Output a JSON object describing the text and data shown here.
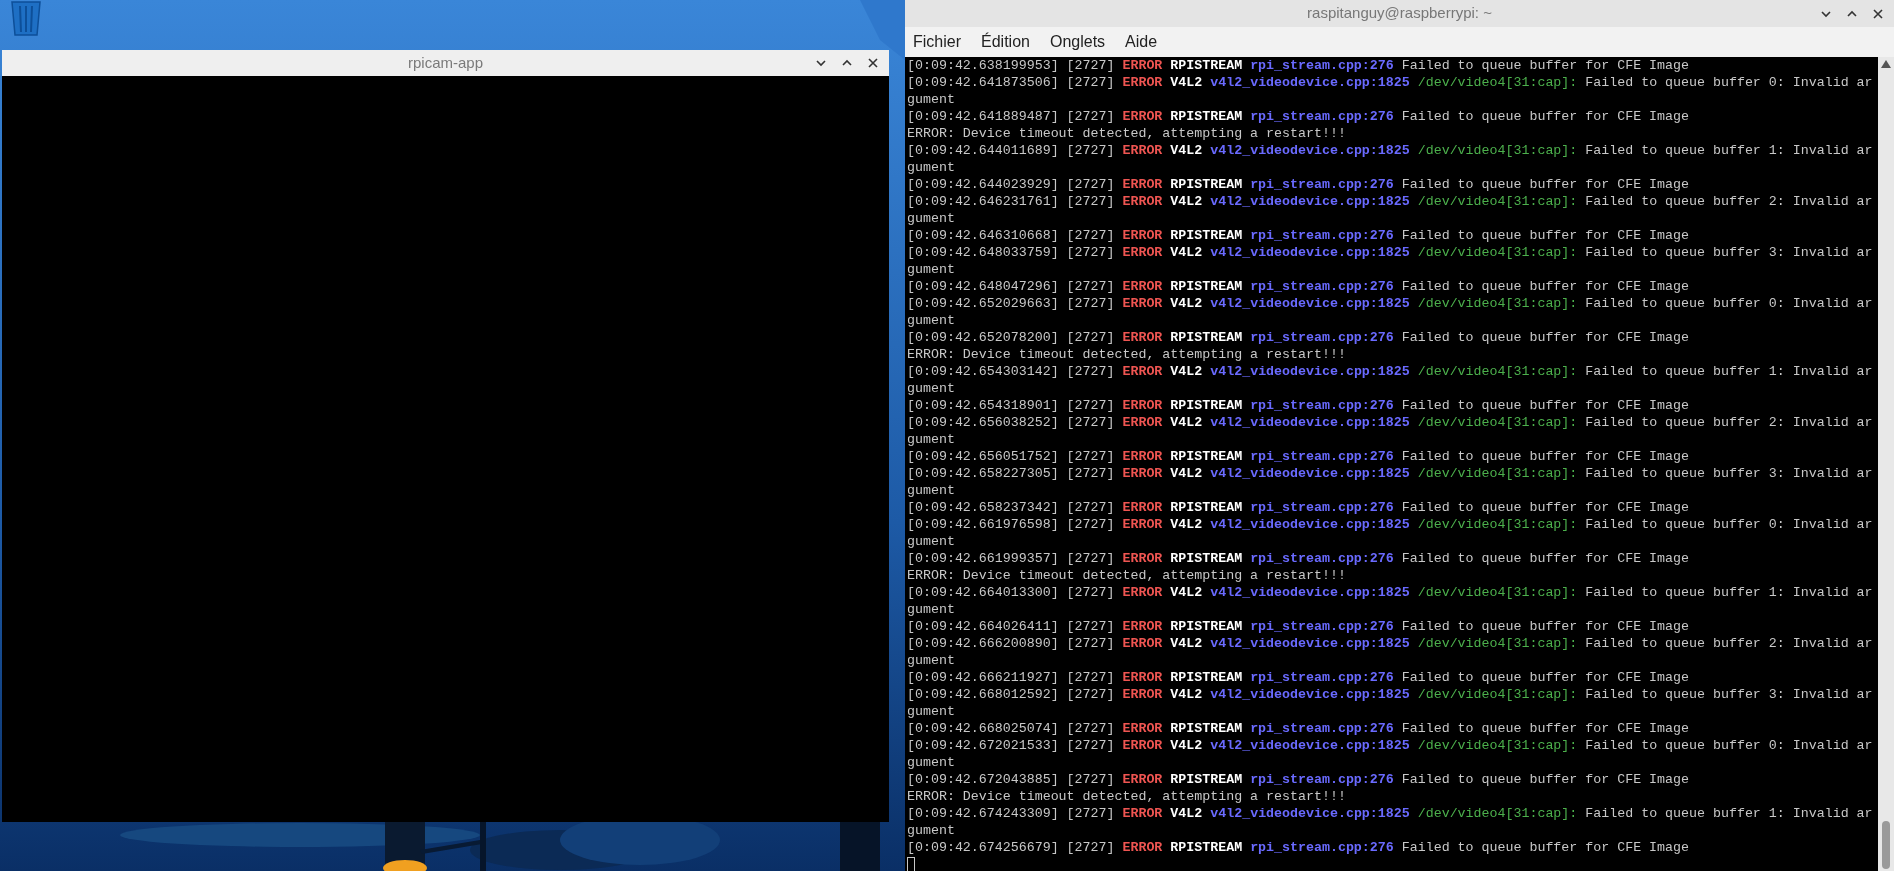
{
  "windows": [
    {
      "kind": "camera",
      "title": "rpicam-app"
    },
    {
      "kind": "terminal",
      "title": "raspitanguy@raspberrypi: ~",
      "menu": [
        "Fichier",
        "Édition",
        "Onglets",
        "Aide"
      ],
      "lines": [
        {
          "kind": "rpi",
          "timestamp": "[0:09:42.638199953]",
          "pid": "[2727]",
          "level": "ERROR",
          "module": "RPISTREAM",
          "source": "rpi_stream.cpp:276",
          "message": "Failed to queue buffer for CFE Image"
        },
        {
          "kind": "v4l2",
          "timestamp": "[0:09:42.641873506]",
          "pid": "[2727]",
          "level": "ERROR",
          "module": "V4L2",
          "source": "v4l2_videodevice.cpp:1825",
          "device": "/dev/video4[31:cap]:",
          "message": "Failed to queue buffer 0: Invalid argument"
        },
        {
          "kind": "rpi",
          "timestamp": "[0:09:42.641889487]",
          "pid": "[2727]",
          "level": "ERROR",
          "module": "RPISTREAM",
          "source": "rpi_stream.cpp:276",
          "message": "Failed to queue buffer for CFE Image"
        },
        {
          "kind": "plain",
          "text": "ERROR: Device timeout detected, attempting a restart!!!"
        },
        {
          "kind": "v4l2",
          "timestamp": "[0:09:42.644011689]",
          "pid": "[2727]",
          "level": "ERROR",
          "module": "V4L2",
          "source": "v4l2_videodevice.cpp:1825",
          "device": "/dev/video4[31:cap]:",
          "message": "Failed to queue buffer 1: Invalid argument"
        },
        {
          "kind": "rpi",
          "timestamp": "[0:09:42.644023929]",
          "pid": "[2727]",
          "level": "ERROR",
          "module": "RPISTREAM",
          "source": "rpi_stream.cpp:276",
          "message": "Failed to queue buffer for CFE Image"
        },
        {
          "kind": "v4l2",
          "timestamp": "[0:09:42.646231761]",
          "pid": "[2727]",
          "level": "ERROR",
          "module": "V4L2",
          "source": "v4l2_videodevice.cpp:1825",
          "device": "/dev/video4[31:cap]:",
          "message": "Failed to queue buffer 2: Invalid argument"
        },
        {
          "kind": "rpi",
          "timestamp": "[0:09:42.646310668]",
          "pid": "[2727]",
          "level": "ERROR",
          "module": "RPISTREAM",
          "source": "rpi_stream.cpp:276",
          "message": "Failed to queue buffer for CFE Image"
        },
        {
          "kind": "v4l2",
          "timestamp": "[0:09:42.648033759]",
          "pid": "[2727]",
          "level": "ERROR",
          "module": "V4L2",
          "source": "v4l2_videodevice.cpp:1825",
          "device": "/dev/video4[31:cap]:",
          "message": "Failed to queue buffer 3: Invalid argument"
        },
        {
          "kind": "rpi",
          "timestamp": "[0:09:42.648047296]",
          "pid": "[2727]",
          "level": "ERROR",
          "module": "RPISTREAM",
          "source": "rpi_stream.cpp:276",
          "message": "Failed to queue buffer for CFE Image"
        },
        {
          "kind": "v4l2",
          "timestamp": "[0:09:42.652029663]",
          "pid": "[2727]",
          "level": "ERROR",
          "module": "V4L2",
          "source": "v4l2_videodevice.cpp:1825",
          "device": "/dev/video4[31:cap]:",
          "message": "Failed to queue buffer 0: Invalid argument"
        },
        {
          "kind": "rpi",
          "timestamp": "[0:09:42.652078200]",
          "pid": "[2727]",
          "level": "ERROR",
          "module": "RPISTREAM",
          "source": "rpi_stream.cpp:276",
          "message": "Failed to queue buffer for CFE Image"
        },
        {
          "kind": "plain",
          "text": "ERROR: Device timeout detected, attempting a restart!!!"
        },
        {
          "kind": "v4l2",
          "timestamp": "[0:09:42.654303142]",
          "pid": "[2727]",
          "level": "ERROR",
          "module": "V4L2",
          "source": "v4l2_videodevice.cpp:1825",
          "device": "/dev/video4[31:cap]:",
          "message": "Failed to queue buffer 1: Invalid argument"
        },
        {
          "kind": "rpi",
          "timestamp": "[0:09:42.654318901]",
          "pid": "[2727]",
          "level": "ERROR",
          "module": "RPISTREAM",
          "source": "rpi_stream.cpp:276",
          "message": "Failed to queue buffer for CFE Image"
        },
        {
          "kind": "v4l2",
          "timestamp": "[0:09:42.656038252]",
          "pid": "[2727]",
          "level": "ERROR",
          "module": "V4L2",
          "source": "v4l2_videodevice.cpp:1825",
          "device": "/dev/video4[31:cap]:",
          "message": "Failed to queue buffer 2: Invalid argument"
        },
        {
          "kind": "rpi",
          "timestamp": "[0:09:42.656051752]",
          "pid": "[2727]",
          "level": "ERROR",
          "module": "RPISTREAM",
          "source": "rpi_stream.cpp:276",
          "message": "Failed to queue buffer for CFE Image"
        },
        {
          "kind": "v4l2",
          "timestamp": "[0:09:42.658227305]",
          "pid": "[2727]",
          "level": "ERROR",
          "module": "V4L2",
          "source": "v4l2_videodevice.cpp:1825",
          "device": "/dev/video4[31:cap]:",
          "message": "Failed to queue buffer 3: Invalid argument"
        },
        {
          "kind": "rpi",
          "timestamp": "[0:09:42.658237342]",
          "pid": "[2727]",
          "level": "ERROR",
          "module": "RPISTREAM",
          "source": "rpi_stream.cpp:276",
          "message": "Failed to queue buffer for CFE Image"
        },
        {
          "kind": "v4l2",
          "timestamp": "[0:09:42.661976598]",
          "pid": "[2727]",
          "level": "ERROR",
          "module": "V4L2",
          "source": "v4l2_videodevice.cpp:1825",
          "device": "/dev/video4[31:cap]:",
          "message": "Failed to queue buffer 0: Invalid argument"
        },
        {
          "kind": "rpi",
          "timestamp": "[0:09:42.661999357]",
          "pid": "[2727]",
          "level": "ERROR",
          "module": "RPISTREAM",
          "source": "rpi_stream.cpp:276",
          "message": "Failed to queue buffer for CFE Image"
        },
        {
          "kind": "plain",
          "text": "ERROR: Device timeout detected, attempting a restart!!!"
        },
        {
          "kind": "v4l2",
          "timestamp": "[0:09:42.664013300]",
          "pid": "[2727]",
          "level": "ERROR",
          "module": "V4L2",
          "source": "v4l2_videodevice.cpp:1825",
          "device": "/dev/video4[31:cap]:",
          "message": "Failed to queue buffer 1: Invalid argument"
        },
        {
          "kind": "rpi",
          "timestamp": "[0:09:42.664026411]",
          "pid": "[2727]",
          "level": "ERROR",
          "module": "RPISTREAM",
          "source": "rpi_stream.cpp:276",
          "message": "Failed to queue buffer for CFE Image"
        },
        {
          "kind": "v4l2",
          "timestamp": "[0:09:42.666200890]",
          "pid": "[2727]",
          "level": "ERROR",
          "module": "V4L2",
          "source": "v4l2_videodevice.cpp:1825",
          "device": "/dev/video4[31:cap]:",
          "message": "Failed to queue buffer 2: Invalid argument"
        },
        {
          "kind": "rpi",
          "timestamp": "[0:09:42.666211927]",
          "pid": "[2727]",
          "level": "ERROR",
          "module": "RPISTREAM",
          "source": "rpi_stream.cpp:276",
          "message": "Failed to queue buffer for CFE Image"
        },
        {
          "kind": "v4l2",
          "timestamp": "[0:09:42.668012592]",
          "pid": "[2727]",
          "level": "ERROR",
          "module": "V4L2",
          "source": "v4l2_videodevice.cpp:1825",
          "device": "/dev/video4[31:cap]:",
          "message": "Failed to queue buffer 3: Invalid argument"
        },
        {
          "kind": "rpi",
          "timestamp": "[0:09:42.668025074]",
          "pid": "[2727]",
          "level": "ERROR",
          "module": "RPISTREAM",
          "source": "rpi_stream.cpp:276",
          "message": "Failed to queue buffer for CFE Image"
        },
        {
          "kind": "v4l2",
          "timestamp": "[0:09:42.672021533]",
          "pid": "[2727]",
          "level": "ERROR",
          "module": "V4L2",
          "source": "v4l2_videodevice.cpp:1825",
          "device": "/dev/video4[31:cap]:",
          "message": "Failed to queue buffer 0: Invalid argument"
        },
        {
          "kind": "rpi",
          "timestamp": "[0:09:42.672043885]",
          "pid": "[2727]",
          "level": "ERROR",
          "module": "RPISTREAM",
          "source": "rpi_stream.cpp:276",
          "message": "Failed to queue buffer for CFE Image"
        },
        {
          "kind": "plain",
          "text": "ERROR: Device timeout detected, attempting a restart!!!"
        },
        {
          "kind": "v4l2",
          "timestamp": "[0:09:42.674243309]",
          "pid": "[2727]",
          "level": "ERROR",
          "module": "V4L2",
          "source": "v4l2_videodevice.cpp:1825",
          "device": "/dev/video4[31:cap]:",
          "message": "Failed to queue buffer 1: Invalid argument"
        },
        {
          "kind": "rpi",
          "timestamp": "[0:09:42.674256679]",
          "pid": "[2727]",
          "level": "ERROR",
          "module": "RPISTREAM",
          "source": "rpi_stream.cpp:276",
          "message": "Failed to queue buffer for CFE Image"
        }
      ]
    }
  ]
}
